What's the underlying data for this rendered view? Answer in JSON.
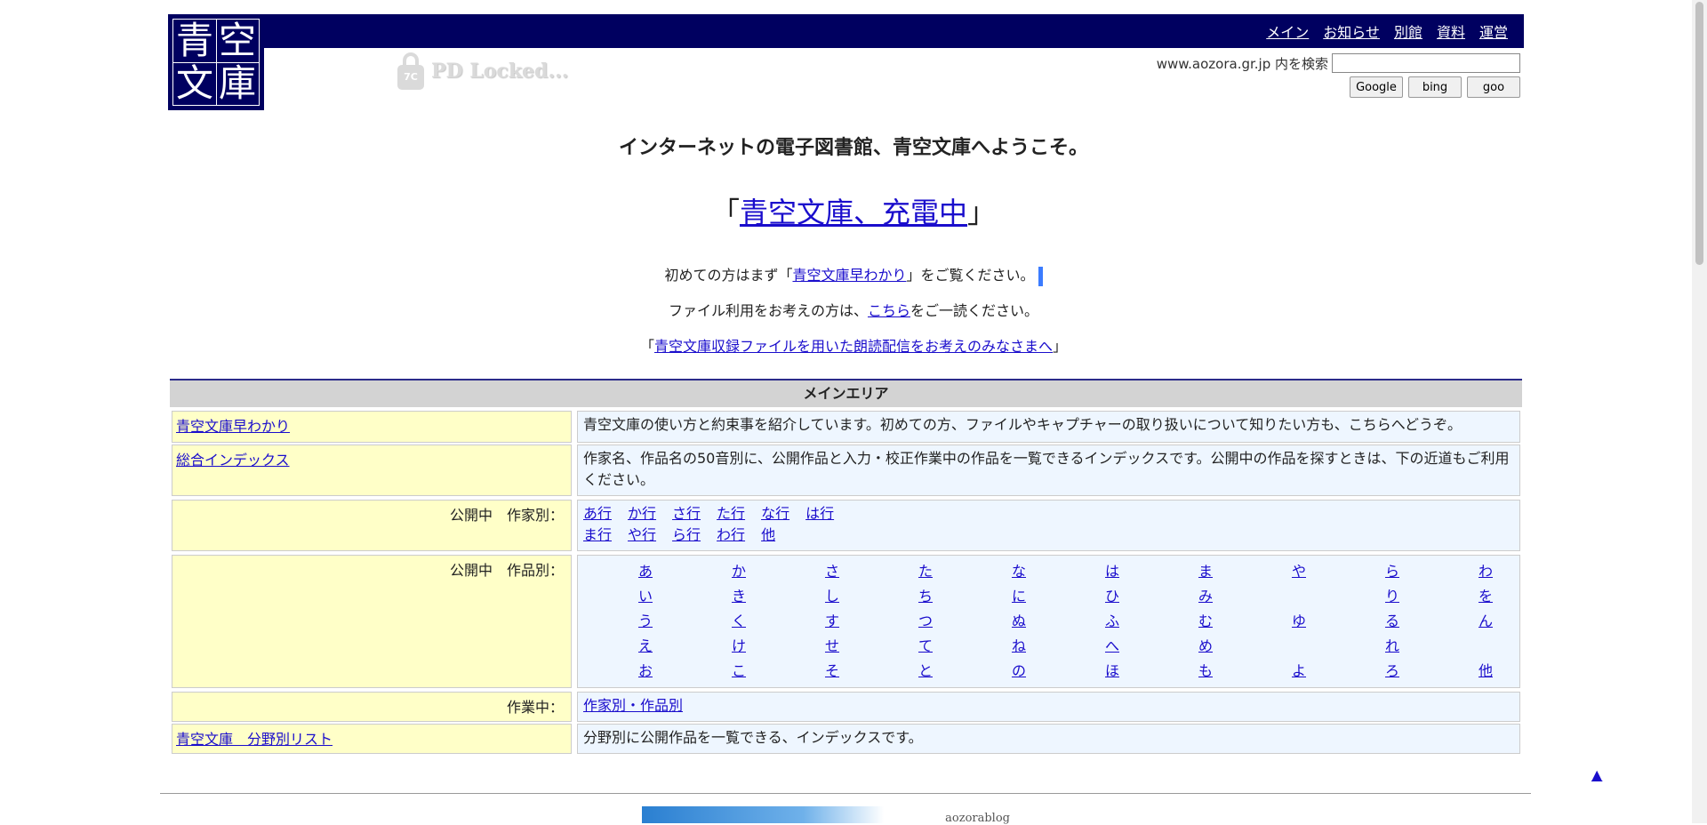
{
  "header": {
    "logo_chars": [
      "青",
      "空",
      "文",
      "庫"
    ],
    "nav": [
      "メイン",
      "お知らせ",
      "別館",
      "資料",
      "運営"
    ],
    "pd_locked": "PD Locked...",
    "pd_badge": "7C",
    "search_label": "www.aozora.gr.jp 内を検索",
    "search_value": "",
    "search_buttons": [
      "Google",
      "bing",
      "goo"
    ]
  },
  "welcome": "インターネットの電子図書館、青空文庫へようこそ。",
  "charging": {
    "open": "「",
    "link": "青空文庫、充電中",
    "close": "」"
  },
  "intro": {
    "line1_pre": "初めての方はまず「",
    "line1_link": "青空文庫早わかり",
    "line1_post": "」をご覧ください。",
    "line2_pre": "ファイル利用をお考えの方は、",
    "line2_link": "こちら",
    "line2_post": "をご一読ください。",
    "line3_pre": "「",
    "line3_link": "青空文庫収録ファイルを用いた朗読配信をお考えのみなさまへ",
    "line3_post": "」"
  },
  "main_area": {
    "title": "メインエリア",
    "rows": [
      {
        "left": "青空文庫早わかり",
        "right": "青空文庫の使い方と約束事を紹介しています。初めての方、ファイルやキャプチャーの取り扱いについて知りたい方も、こちらへどうぞ。"
      },
      {
        "left": "総合インデックス",
        "right": "作家名、作品名の50音別に、公開作品と入力・校正作業中の作品を一覧できるインデックスです。公開中の作品を探すときは、下の近道もご利用ください。"
      }
    ],
    "authors_label": "公開中　作家別：",
    "authors_row1": [
      "あ行",
      "か行",
      "さ行",
      "た行",
      "な行",
      "は行"
    ],
    "authors_row2": [
      "ま行",
      "や行",
      "ら行",
      "わ行",
      "他"
    ],
    "works_label": "公開中　作品別：",
    "works_columns": [
      [
        "あ",
        "い",
        "う",
        "え",
        "お"
      ],
      [
        "か",
        "き",
        "く",
        "け",
        "こ"
      ],
      [
        "さ",
        "し",
        "す",
        "せ",
        "そ"
      ],
      [
        "た",
        "ち",
        "つ",
        "て",
        "と"
      ],
      [
        "な",
        "に",
        "ぬ",
        "ね",
        "の"
      ],
      [
        "は",
        "ひ",
        "ふ",
        "へ",
        "ほ"
      ],
      [
        "ま",
        "み",
        "む",
        "め",
        "も"
      ],
      [
        "や",
        "",
        "ゆ",
        "",
        "よ"
      ],
      [
        "ら",
        "り",
        "る",
        "れ",
        "ろ"
      ],
      [
        "わ",
        "を",
        "ん",
        "",
        "他"
      ]
    ],
    "inprogress_label": "作業中：",
    "inprogress_link": "作家別・作品別",
    "category_link": "青空文庫　分野別リスト",
    "category_desc": "分野別に公開作品を一覧できる、インデックスです。"
  },
  "to_top": "▲",
  "blog_banner": "aozorablog"
}
